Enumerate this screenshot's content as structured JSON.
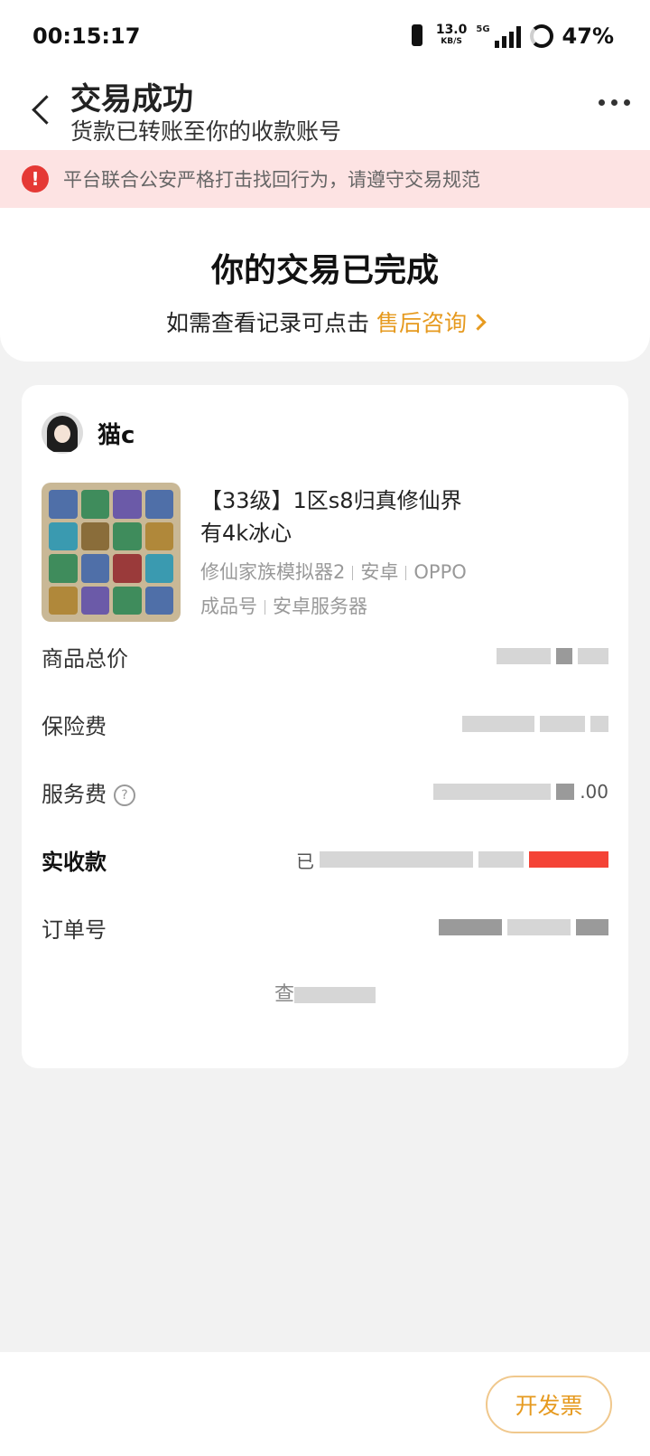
{
  "status_bar": {
    "time": "00:15:17",
    "net_speed": "13.0",
    "net_speed_unit": "KB/S",
    "network": "5G",
    "battery": "47%"
  },
  "header": {
    "title": "交易成功",
    "subtitle": "货款已转账至你的收款账号"
  },
  "warning": {
    "icon_text": "!",
    "text": "平台联合公安严格打击找回行为，请遵守交易规范"
  },
  "completion": {
    "title": "你的交易已完成",
    "prompt": "如需查看记录可点击",
    "link": "售后咨询"
  },
  "order": {
    "seller_name": "猫c",
    "product_title_line1": "【33级】1区s8归真修仙界",
    "product_title_line2": "有4k冰心",
    "meta": {
      "game": "修仙家族模拟器2",
      "platform": "安卓",
      "brand": "OPPO",
      "type": "成品号",
      "server": "安卓服务器"
    },
    "rows": {
      "total_label": "商品总价",
      "insurance_label": "保险费",
      "service_label": "服务费",
      "service_value_tail": ".00",
      "received_label": "实收款",
      "received_prefix": "已",
      "order_no_label": "订单号"
    },
    "view_more": "查"
  },
  "bottom": {
    "invoice_button": "开发票"
  },
  "colors": {
    "accent": "#e69a1f",
    "warning_bg": "#fde3e3",
    "warning_icon": "#e53935",
    "amount_red": "#f44336"
  }
}
